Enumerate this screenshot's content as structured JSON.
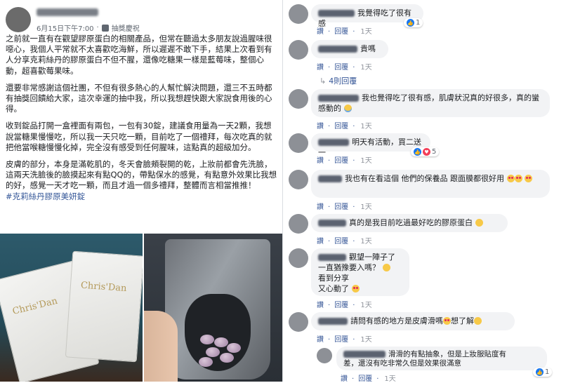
{
  "post": {
    "date": "6月15日下午7:00",
    "activity": "抽獎慶祝",
    "paragraphs": [
      "之前就一直有在觀望膠原蛋白的相關產品，但常在聽過太多朋友說過腥味很噁心，我個人平常就不太喜歡吃海鮮，所以遲遲不敢下手，結果上次看到有人分享克莉絲丹的膠原蛋白不但不腥，還像吃糖果一樣是藍莓味，整個心動，超喜歡莓果味。",
      "還要非常感謝這個社團，不但有很多熱心的人幫忙解決問題，還三不五時都有抽獎回饋給大家，這次幸運的抽中我，所以我想趕快跟大家說食用後的心得。",
      "收到錠品打開一盒裡面有兩包，一包有30錠，建議食用量為一天2顆，我想說當糖果慢慢吃，所以我一天只吃一顆，目前吃了一個禮拜，每次吃真的就把他當喉糖慢慢化掉，完全沒有感受到任何腥味，這點真的超級加分。",
      "皮膚的部分，本身是滿乾肌的，冬天會臉頰裂開的乾，上妝前都會先洗臉，這兩天洗臉後的臉摸起來有點QQ的，帶點保水的感覺，有點意外效果比我想的好，感覺一天才吃一顆，而且才過一個多禮拜，整體而言相當推推！"
    ],
    "hashtag": "#克莉絲丹膠原美妍錠",
    "packet_brand": "Chris'Dan"
  },
  "comment_actions": {
    "like": "讚",
    "reply": "回覆"
  },
  "comments": [
    {
      "text": "我覺得吃了很有感",
      "time": "1天",
      "reactions": "1"
    },
    {
      "text": "貴嗎",
      "time": "1天",
      "reactions": ""
    },
    {
      "reply_link": "4則回覆"
    },
    {
      "text": "我也覺得吃了很有感，肌膚狀況真的好很多，真的蠻感動的",
      "time": "1天",
      "reactions": ""
    },
    {
      "text": "明天有活動，買二送一",
      "time": "1天",
      "reactions": "5"
    },
    {
      "text": "我也有在看這個 他們的保養品 跟面膜都很好用",
      "time": "1天",
      "reactions": ""
    },
    {
      "text": "真的是我目前吃過最好吃的膠原蛋白",
      "time": "1天",
      "reactions": ""
    },
    {
      "text": "觀望一陣子了 一直猶豫要入嗎？ 看到分享 又心動了",
      "line1": "觀望一陣子了",
      "line2": "一直猶豫要入嗎？",
      "line3": "看到分享",
      "line4": "又心動了",
      "time": "1天",
      "reactions": ""
    },
    {
      "text": "請問有感的地方是皮膚滑嗎",
      "tail": "想了解",
      "time": "1天",
      "reactions": ""
    },
    {
      "text": "滑滑的有點抽象，但是上妝服貼度有差，還沒有吃非常久但是效果很滿意",
      "line1": "滑滑的有點抽象，但是上妝服貼度有",
      "line2": "差，還沒有吃非常久但是效果很滿意",
      "time": "1天",
      "reactions": "1"
    }
  ]
}
